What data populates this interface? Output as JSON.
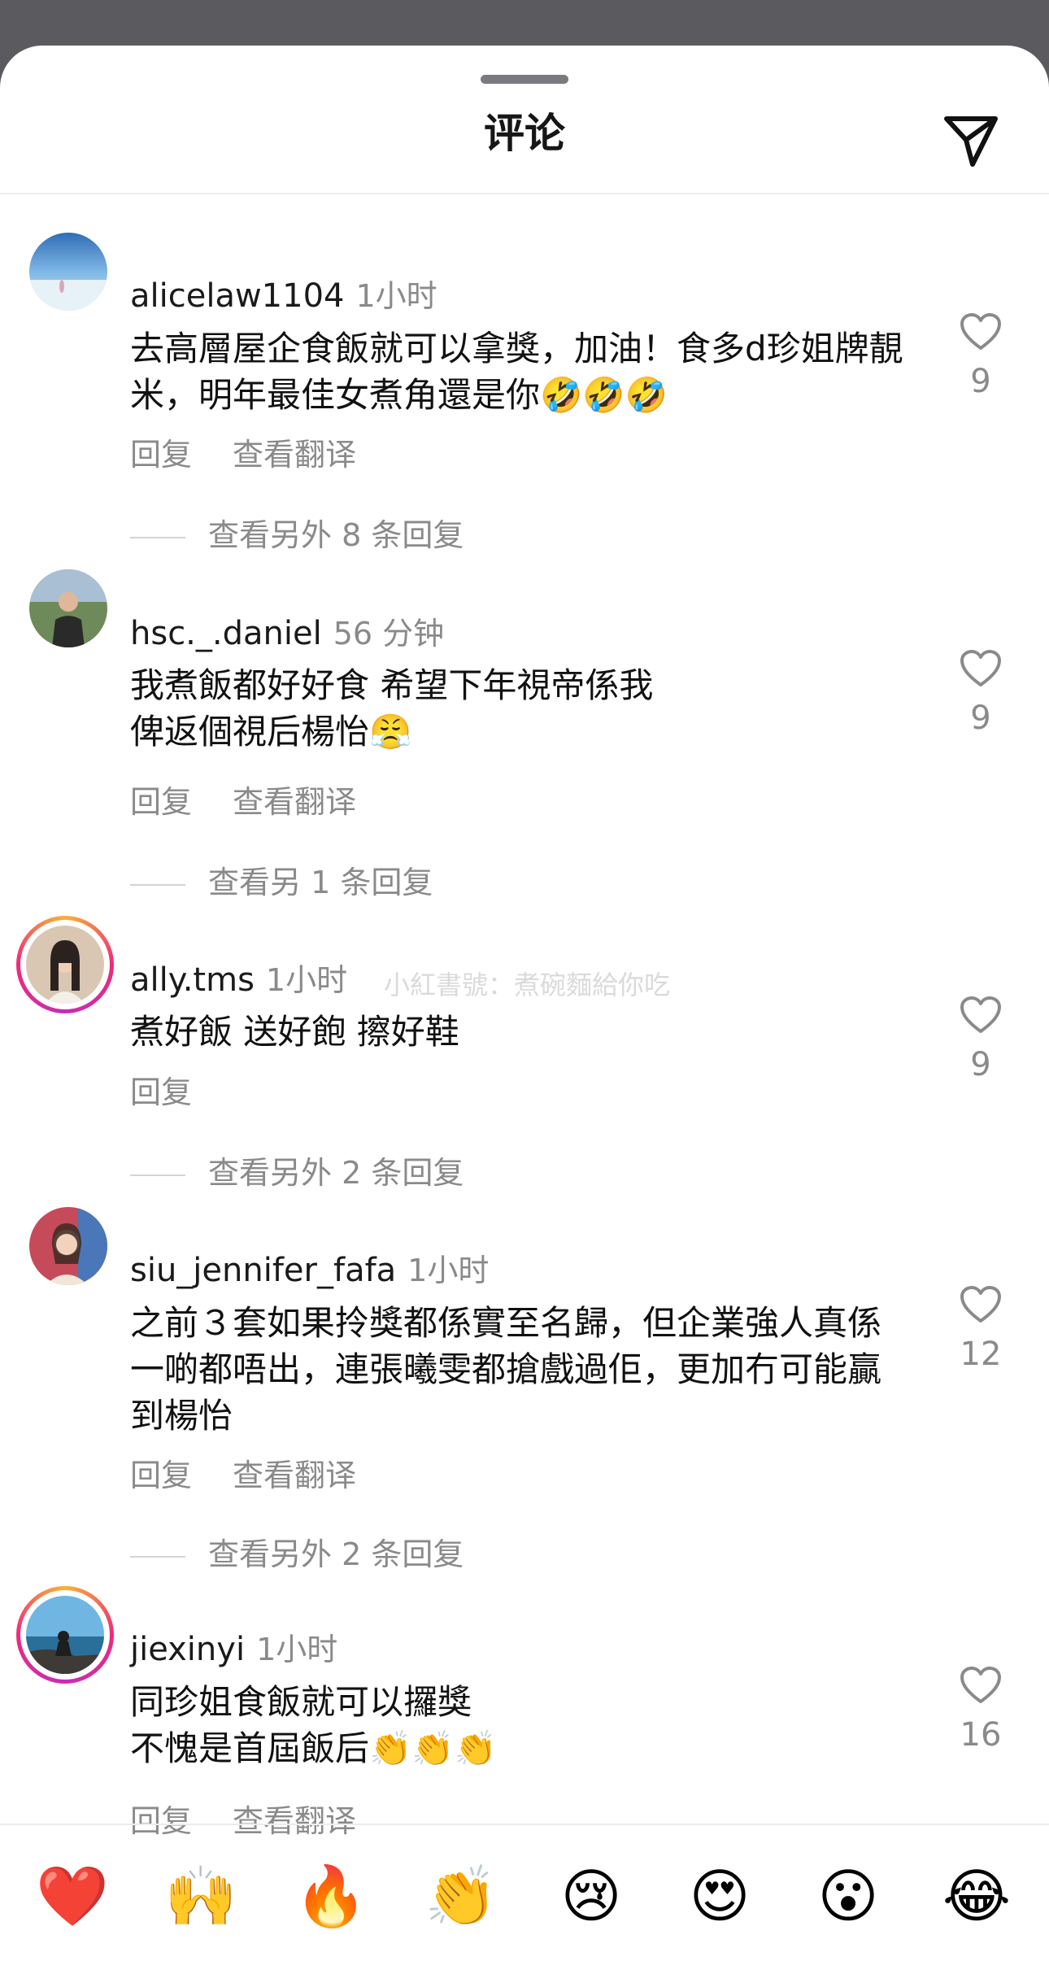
{
  "header": {
    "title": "评论",
    "send_icon": "paper-plane-icon"
  },
  "comments": [
    {
      "username": "alicelaw1104",
      "time": "1小时",
      "text": "去高層屋企食飯就可以拿獎，加油！食多d珍姐牌靚米，明年最佳女煮角還是你🤣🤣🤣",
      "reply_label": "回复",
      "translate_label": "查看翻译",
      "view_replies": "查看另外 8 条回复",
      "likes": "9",
      "avatar": "beach-sunset-avatar"
    },
    {
      "username": "hsc._.daniel",
      "time": "56 分钟",
      "text": "我煮飯都好好食 希望下年視帝係我\n俾返個視后楊怡😤",
      "reply_label": "回复",
      "translate_label": "查看翻译",
      "view_replies": "查看另 1 条回复",
      "likes": "9",
      "avatar": "man-outdoors-avatar"
    },
    {
      "username": "ally.tms",
      "time": "1小时",
      "text": "煮好飯 送好飽 擦好鞋",
      "reply_label": "回复",
      "view_replies": "查看另外 2 条回复",
      "likes": "9",
      "avatar": "woman-portrait-avatar"
    },
    {
      "username": "siu_jennifer_fafa",
      "time": "1小时",
      "text": "之前３套如果拎獎都係實至名歸，但企業強人真係一啲都唔出，連張曦雯都搶戲過佢，更加冇可能贏到楊怡",
      "reply_label": "回复",
      "translate_label": "查看翻译",
      "view_replies": "查看另外 2 条回复",
      "likes": "12",
      "avatar": "woman-selfie-avatar"
    },
    {
      "username": "jiexinyi",
      "time": "1小时",
      "text": "同珍姐食飯就可以攞獎\n不愧是首屆飯后👏👏👏",
      "reply_label": "回复",
      "translate_label": "查看翻译",
      "likes": "16",
      "avatar": "seaside-avatar"
    }
  ],
  "watermark": "小紅書號：煮碗麵給你吃",
  "emoji_bar": [
    {
      "glyph": "❤️",
      "name": "red-heart"
    },
    {
      "glyph": "🙌",
      "name": "raising-hands"
    },
    {
      "glyph": "🔥",
      "name": "fire"
    },
    {
      "glyph": "👏",
      "name": "clapping-hands"
    },
    {
      "glyph": "😢",
      "name": "crying-face"
    },
    {
      "glyph": "😍",
      "name": "heart-eyes"
    },
    {
      "glyph": "😮",
      "name": "surprised-face"
    },
    {
      "glyph": "😂",
      "name": "tears-of-joy"
    }
  ]
}
